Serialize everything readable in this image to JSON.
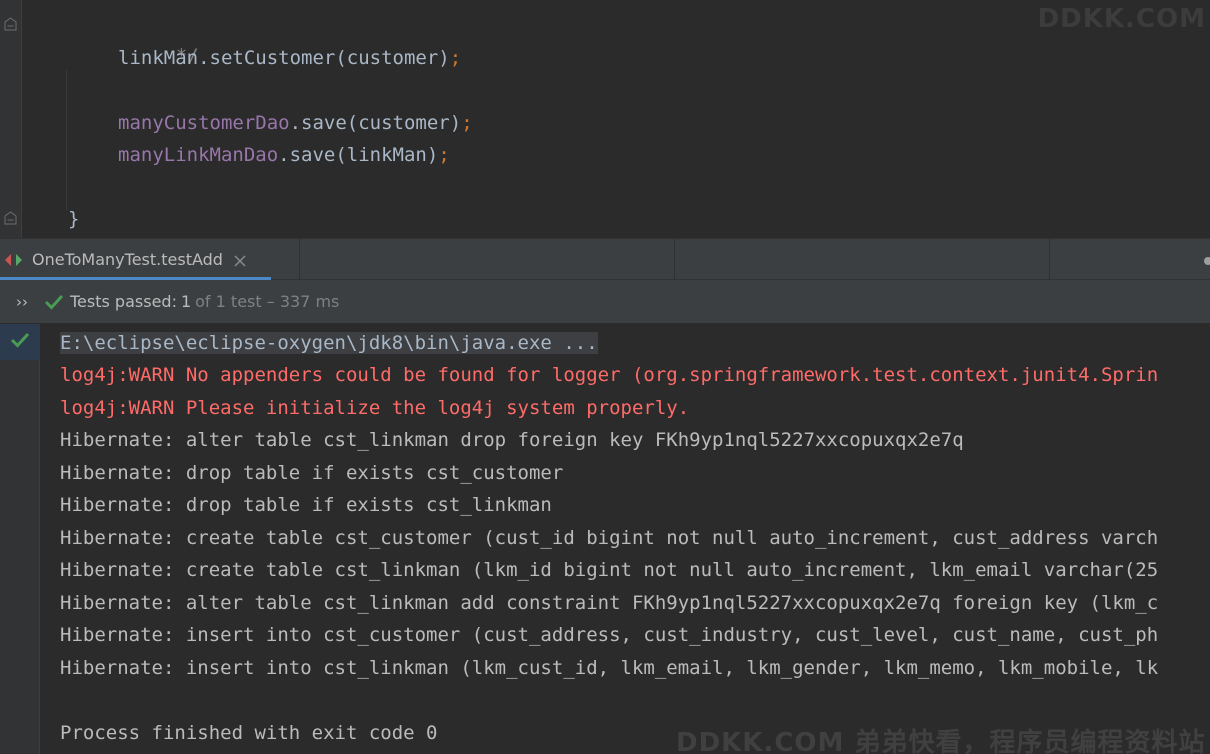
{
  "editor": {
    "lines": [
      {
        "type": "comment",
        "text": "*/"
      },
      {
        "type": "plain",
        "text": "linkMan.setCustomer(customer)",
        "semi": ";"
      },
      {
        "type": "field",
        "field": "manyCustomerDao",
        "text": ".save(customer)",
        "semi": ";"
      },
      {
        "type": "field",
        "field": "manyLinkManDao",
        "text": ".save(linkMan)",
        "semi": ";"
      },
      {
        "type": "plain",
        "text": "}"
      }
    ]
  },
  "watermark": {
    "top": "DDKK.COM",
    "bottom": "DDKK.COM 弟弟快看，程序员编程资料站"
  },
  "run_tab": {
    "label": "OneToManyTest.testAdd"
  },
  "status": {
    "label": "Tests passed:",
    "count": "1",
    "rest": "of 1 test – 337 ms"
  },
  "console": {
    "lines": [
      {
        "style": "cmd",
        "text": "E:\\eclipse\\eclipse-oxygen\\jdk8\\bin\\java.exe ..."
      },
      {
        "style": "warn",
        "text": "log4j:WARN No appenders could be found for logger (org.springframework.test.context.junit4.Sprin"
      },
      {
        "style": "warn",
        "text": "log4j:WARN Please initialize the log4j system properly."
      },
      {
        "style": "normal",
        "text": "Hibernate: alter table cst_linkman drop foreign key FKh9yp1nql5227xxcopuxqx2e7q"
      },
      {
        "style": "normal",
        "text": "Hibernate: drop table if exists cst_customer"
      },
      {
        "style": "normal",
        "text": "Hibernate: drop table if exists cst_linkman"
      },
      {
        "style": "normal",
        "text": "Hibernate: create table cst_customer (cust_id bigint not null auto_increment, cust_address varch"
      },
      {
        "style": "normal",
        "text": "Hibernate: create table cst_linkman (lkm_id bigint not null auto_increment, lkm_email varchar(25"
      },
      {
        "style": "normal",
        "text": "Hibernate: alter table cst_linkman add constraint FKh9yp1nql5227xxcopuxqx2e7q foreign key (lkm_c"
      },
      {
        "style": "normal",
        "text": "Hibernate: insert into cst_customer (cust_address, cust_industry, cust_level, cust_name, cust_ph"
      },
      {
        "style": "normal",
        "text": "Hibernate: insert into cst_linkman (lkm_cust_id, lkm_email, lkm_gender, lkm_memo, lkm_mobile, lk"
      },
      {
        "style": "blank",
        "text": ""
      },
      {
        "style": "normal",
        "text": "Process finished with exit code 0"
      }
    ]
  }
}
